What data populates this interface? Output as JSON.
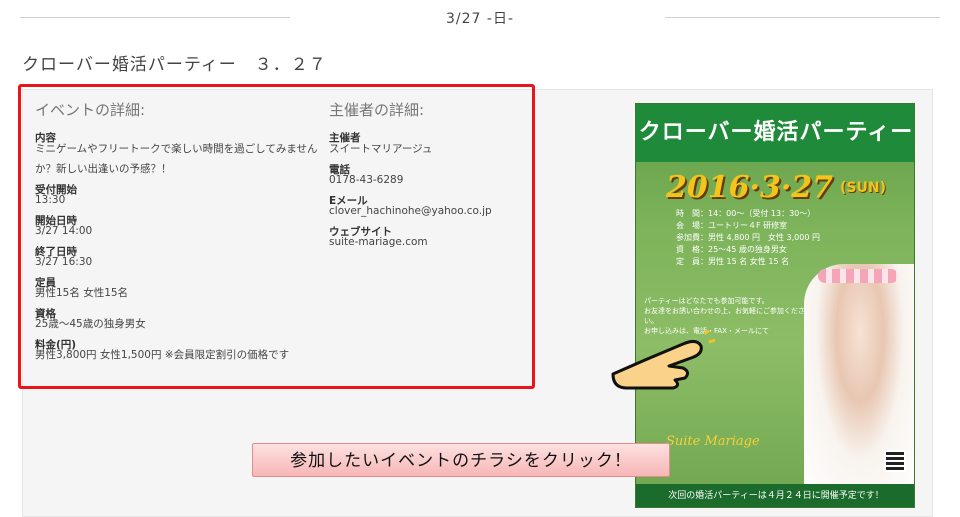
{
  "header": {
    "date_label": "3/27 -日-"
  },
  "event": {
    "title": "クローバー婚活パーティー　３．２７"
  },
  "details": {
    "heading": "イベントの詳細:",
    "content_label": "内容",
    "content_line1": "ミニゲームやフリートークで楽しい時間を過ごしてみません",
    "content_line2": "か？新しい出逢いの予感？！",
    "reception_label": "受付開始",
    "reception_value": "13:30",
    "start_label": "開始日時",
    "start_value": "3/27 14:00",
    "end_label": "終了日時",
    "end_value": "3/27 16:30",
    "capacity_label": "定員",
    "capacity_value": "男性15名  女性15名",
    "qualification_label": "資格",
    "qualification_value": "25歳～45歳の独身男女",
    "fee_label": "料金(円)",
    "fee_value": "男性3,800円  女性1,500円  ※会員限定割引の価格です"
  },
  "organizer": {
    "heading": "主催者の詳細:",
    "org_label": "主催者",
    "org_value": "スイートマリアージュ",
    "phone_label": "電話",
    "phone_value": "0178-43-6289",
    "email_label": "Eメール",
    "email_value": "clover_hachinohe@yahoo.co.jp",
    "website_label": "ウェブサイト",
    "website_value": "suite-mariage.com"
  },
  "flyer": {
    "title": "クローバー婚活パーティー",
    "date": "2016·3·27",
    "day": "(SUN)",
    "info_time": "時　間：14：00～（受付 13：30～）",
    "info_venue": "会　場：ユートリー４F 研修室",
    "info_fee": "参加費：男性 4,800 円　女性 3,000 円",
    "info_qualification": "資　格：25～45 歳の独身男女",
    "info_capacity": "定　員：男性 15 名  女性 15 名",
    "body_1": "パーティーはどなたでも参加可能です。",
    "body_2": "お友達をお誘い合わせの上、お気軽にご参加ください。",
    "body_3": "お申し込みは、電話・FAX・メールにて",
    "logo": "Suite Mariage",
    "footer": "次回の婚活パーティーは４月２４日に開催予定です！"
  },
  "icons": {
    "pointer": "pointing-hand-icon"
  },
  "cta": {
    "label": "参加したいイベントのチラシをクリック！"
  },
  "colors": {
    "highlight_border": "#e8151b",
    "flyer_green": "#1f8a3a",
    "cta_bg": "#f7b6b6"
  }
}
